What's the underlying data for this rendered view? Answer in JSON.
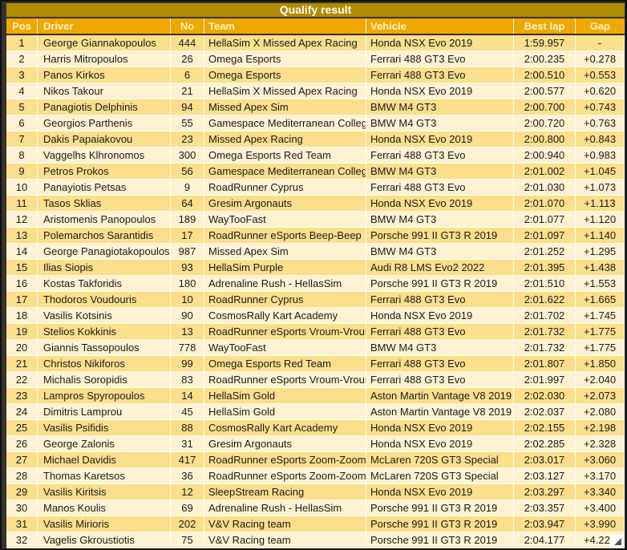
{
  "title": "Qualify result",
  "columns": [
    "Pos",
    "Driver",
    "No",
    "Team",
    "Vehicle",
    "Best lap",
    "Gap"
  ],
  "rows": [
    [
      "1",
      "George Giannakopoulos",
      "444",
      "HellaSim X Missed Apex Racing",
      "Honda NSX Evo 2019",
      "1:59.957",
      "-"
    ],
    [
      "2",
      "Harris Mitropoulos",
      "26",
      "Omega Esports",
      "Ferrari 488 GT3 Evo",
      "2:00.235",
      "+0.278"
    ],
    [
      "3",
      "Panos Kirkos",
      "6",
      "Omega Esports",
      "Ferrari 488 GT3 Evo",
      "2:00.510",
      "+0.553"
    ],
    [
      "4",
      "Nikos Takour",
      "21",
      "HellaSim X Missed Apex Racing",
      "Honda NSX Evo 2019",
      "2:00.577",
      "+0.620"
    ],
    [
      "5",
      "Panagiotis Delphinis",
      "94",
      "Missed Apex Sim",
      "BMW M4 GT3",
      "2:00.700",
      "+0.743"
    ],
    [
      "6",
      "Georgios Parthenis",
      "55",
      "Gamespace Mediterranean College",
      "BMW M4 GT3",
      "2:00.720",
      "+0.763"
    ],
    [
      "7",
      "Dakis Papaiakovou",
      "23",
      "Missed Apex Racing",
      "Honda NSX Evo 2019",
      "2:00.800",
      "+0.843"
    ],
    [
      "8",
      "Vaggelhs Klhronomos",
      "300",
      "Omega Esports Red Team",
      "Ferrari 488 GT3 Evo",
      "2:00.940",
      "+0.983"
    ],
    [
      "9",
      "Petros Prokos",
      "56",
      "Gamespace Mediterranean College",
      "BMW M4 GT3",
      "2:01.002",
      "+1.045"
    ],
    [
      "10",
      "Panayiotis Petsas",
      "9",
      "RoadRunner Cyprus",
      "Ferrari 488 GT3 Evo",
      "2:01.030",
      "+1.073"
    ],
    [
      "11",
      "Tasos Sklias",
      "64",
      "Gresim Argonauts",
      "Honda NSX Evo 2019",
      "2:01.070",
      "+1.113"
    ],
    [
      "12",
      "Aristomenis Panopoulos",
      "189",
      "WayTooFast",
      "BMW M4 GT3",
      "2:01.077",
      "+1.120"
    ],
    [
      "13",
      "Polemarchos Sarantidis",
      "17",
      "RoadRunner eSports Beep-Beep",
      "Porsche 991 II GT3 R 2019",
      "2:01.097",
      "+1.140"
    ],
    [
      "14",
      "George Panagiotakopoulos",
      "987",
      "Missed Apex Sim",
      "BMW M4 GT3",
      "2:01.252",
      "+1.295"
    ],
    [
      "15",
      "Ilias Siopis",
      "93",
      "HellaSim Purple",
      "Audi R8 LMS Evo2 2022",
      "2:01.395",
      "+1.438"
    ],
    [
      "16",
      "Kostas Takforidis",
      "180",
      "Adrenaline Rush - HellasSim",
      "Porsche 991 II GT3 R 2019",
      "2:01.510",
      "+1.553"
    ],
    [
      "17",
      "Thodoros Voudouris",
      "10",
      "RoadRunner Cyprus",
      "Ferrari 488 GT3 Evo",
      "2:01.622",
      "+1.665"
    ],
    [
      "18",
      "Vasilis Kotsinis",
      "90",
      "CosmosRally Kart Academy",
      "Honda NSX Evo 2019",
      "2:01.702",
      "+1.745"
    ],
    [
      "19",
      "Stelios Kokkinis",
      "13",
      "RoadRunner eSports Vroum-Vroum",
      "Ferrari 488 GT3 Evo",
      "2:01.732",
      "+1.775"
    ],
    [
      "20",
      "Giannis Tassopoulos",
      "778",
      "WayTooFast",
      "BMW M4 GT3",
      "2:01.732",
      "+1.775"
    ],
    [
      "21",
      "Christos Nikiforos",
      "99",
      "Omega Esports Red Team",
      "Ferrari 488 GT3 Evo",
      "2:01.807",
      "+1.850"
    ],
    [
      "22",
      "Michalis Soropidis",
      "83",
      "RoadRunner eSports Vroum-Vroum",
      "Ferrari 488 GT3 Evo",
      "2:01.997",
      "+2.040"
    ],
    [
      "23",
      "Lampros Spyropoulos",
      "14",
      "HellaSim Gold",
      "Aston Martin Vantage V8 2019",
      "2:02.030",
      "+2.073"
    ],
    [
      "24",
      "Dimitris Lamprou",
      "45",
      "HellaSim Gold",
      "Aston Martin Vantage V8 2019",
      "2:02.037",
      "+2.080"
    ],
    [
      "25",
      "Vasilis Psifidis",
      "88",
      "CosmosRally Kart Academy",
      "Honda NSX Evo 2019",
      "2:02.155",
      "+2.198"
    ],
    [
      "26",
      "George Zalonis",
      "31",
      "Gresim Argonauts",
      "Honda NSX Evo 2019",
      "2:02.285",
      "+2.328"
    ],
    [
      "27",
      "Michael Davidis",
      "417",
      "RoadRunner eSports Zoom-Zoom",
      "McLaren 720S GT3 Special",
      "2:03.017",
      "+3.060"
    ],
    [
      "28",
      "Thomas Karetsos",
      "36",
      "RoadRunner eSports Zoom-Zoom",
      "McLaren 720S GT3 Special",
      "2:03.127",
      "+3.170"
    ],
    [
      "29",
      "Vasilis Kiritsis",
      "12",
      "SleepStream Racing",
      "Honda NSX Evo 2019",
      "2:03.297",
      "+3.340"
    ],
    [
      "30",
      "Manos Koulis",
      "69",
      "Adrenaline Rush - HellasSim",
      "Porsche 991 II GT3 R 2019",
      "2:03.357",
      "+3.400"
    ],
    [
      "31",
      "Vasilis Mirioris",
      "202",
      "V&V Racing team",
      "Porsche 991 II GT3 R 2019",
      "2:03.947",
      "+3.990"
    ],
    [
      "32",
      "Vagelis Gkroustiotis",
      "75",
      "V&V Racing team",
      "Porsche 991 II GT3 R 2019",
      "2:04.177",
      "+4.220"
    ]
  ],
  "colors": {
    "title_bg": "#B18B00",
    "title_text": "#FFFDF6",
    "header_bg": "#F0A702",
    "header_text": "#FFF3C2",
    "row_odd": "#FBDF8D",
    "row_even": "#FDF2D2",
    "frame": "#35332B",
    "handle_blue": "#44546A"
  },
  "icons": {
    "resize_handle": "corner-triangle"
  }
}
